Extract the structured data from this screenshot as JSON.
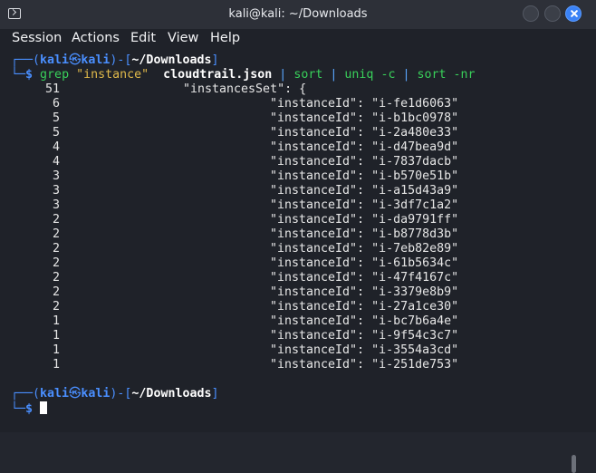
{
  "window": {
    "title": "kali@kali: ~/Downloads",
    "icon": "terminal-icon"
  },
  "menu": [
    "Session",
    "Actions",
    "Edit",
    "View",
    "Help"
  ],
  "prompt": {
    "user": "kali",
    "at_symbol": "㉿",
    "host": "kali",
    "cwd": "~/Downloads",
    "dollar": "$"
  },
  "command": {
    "cmd1": "grep",
    "arg_pattern": "\"instance\"",
    "arg_file": "cloudtrail.json",
    "pipe": "|",
    "cmd2": "sort",
    "cmd3": "uniq",
    "cmd3_flag": "-c",
    "cmd4": "sort",
    "cmd4_flag": "-nr"
  },
  "output": {
    "first_count": "51",
    "first_text": "\"instancesSet\": {",
    "rows": [
      {
        "count": "6",
        "text": "\"instanceId\": \"i-fe1d6063\""
      },
      {
        "count": "5",
        "text": "\"instanceId\": \"i-b1bc0978\""
      },
      {
        "count": "5",
        "text": "\"instanceId\": \"i-2a480e33\""
      },
      {
        "count": "4",
        "text": "\"instanceId\": \"i-d47bea9d\""
      },
      {
        "count": "4",
        "text": "\"instanceId\": \"i-7837dacb\""
      },
      {
        "count": "3",
        "text": "\"instanceId\": \"i-b570e51b\""
      },
      {
        "count": "3",
        "text": "\"instanceId\": \"i-a15d43a9\""
      },
      {
        "count": "3",
        "text": "\"instanceId\": \"i-3df7c1a2\""
      },
      {
        "count": "2",
        "text": "\"instanceId\": \"i-da9791ff\""
      },
      {
        "count": "2",
        "text": "\"instanceId\": \"i-b8778d3b\""
      },
      {
        "count": "2",
        "text": "\"instanceId\": \"i-7eb82e89\""
      },
      {
        "count": "2",
        "text": "\"instanceId\": \"i-61b5634c\""
      },
      {
        "count": "2",
        "text": "\"instanceId\": \"i-47f4167c\""
      },
      {
        "count": "2",
        "text": "\"instanceId\": \"i-3379e8b9\""
      },
      {
        "count": "2",
        "text": "\"instanceId\": \"i-27a1ce30\""
      },
      {
        "count": "1",
        "text": "\"instanceId\": \"i-bc7b6a4e\""
      },
      {
        "count": "1",
        "text": "\"instanceId\": \"i-9f54c3c7\""
      },
      {
        "count": "1",
        "text": "\"instanceId\": \"i-3554a3cd\""
      },
      {
        "count": "1",
        "text": "\"instanceId\": \"i-251de753\""
      }
    ]
  },
  "colors": {
    "prompt_blue": "#4a8fff",
    "path_white": "#ffffff",
    "command_green": "#39d05a",
    "string_yellow": "#e0b94a",
    "close_button": "#3a82f6"
  }
}
